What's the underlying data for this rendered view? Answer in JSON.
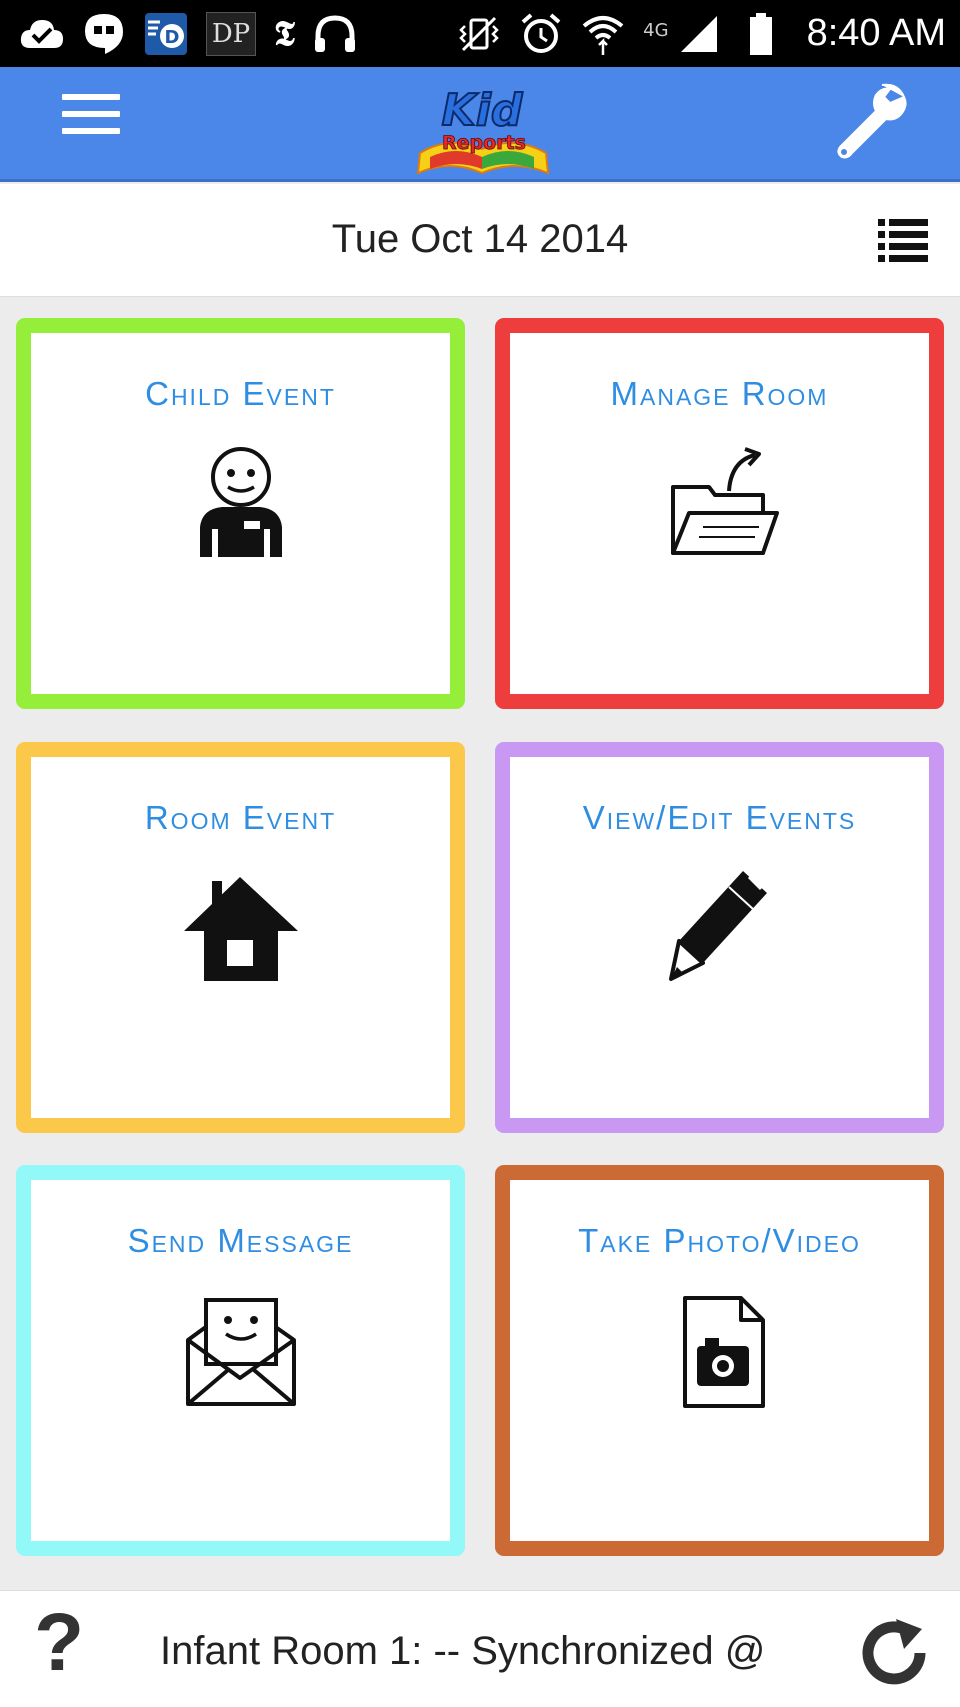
{
  "status_bar": {
    "time": "8:40 AM",
    "network": "4G",
    "icons": [
      "checkmark-cloud-icon",
      "hangouts-icon",
      "dictionary-icon",
      "dp-icon",
      "nyt-icon",
      "headphones-icon",
      "vibrate-icon",
      "alarm-icon",
      "wifi-icon",
      "signal-icon",
      "battery-icon"
    ],
    "dp_label": "DP",
    "nyt_label": "𝕿"
  },
  "app_bar": {
    "logo_line1": "Kid",
    "logo_line2": "Reports",
    "color": "#4a87e8"
  },
  "date_bar": {
    "date": "Tue Oct 14 2014"
  },
  "tiles": [
    {
      "label": "Child Event",
      "icon": "child-icon",
      "border_color": "#95ee3a"
    },
    {
      "label": "Manage Room",
      "icon": "folder-icon",
      "border_color": "#ee3d3d"
    },
    {
      "label": "Room Event",
      "icon": "house-icon",
      "border_color": "#fbc84a"
    },
    {
      "label": "View/Edit Events",
      "icon": "pencil-icon",
      "border_color": "#c898f2"
    },
    {
      "label": "Send Message",
      "icon": "envelope-icon",
      "border_color": "#93f8f8"
    },
    {
      "label": "Take Photo/Video",
      "icon": "photo-file-icon",
      "border_color": "#cc6a35"
    }
  ],
  "bottom_bar": {
    "help": "?",
    "sync_text": "Infant Room 1: --  Synchronized @"
  }
}
